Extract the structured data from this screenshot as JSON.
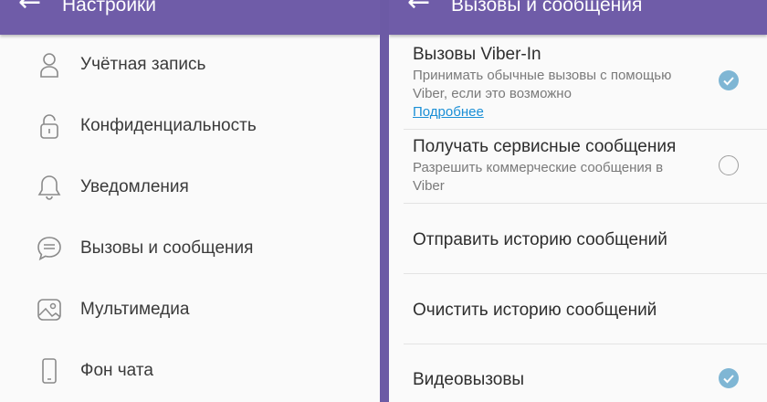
{
  "left_screen": {
    "title": "Настройки",
    "items": [
      {
        "label": "Учётная запись",
        "icon": "person-icon"
      },
      {
        "label": "Конфиденциальность",
        "icon": "lock-icon"
      },
      {
        "label": "Уведомления",
        "icon": "bell-icon"
      },
      {
        "label": "Вызовы и сообщения",
        "icon": "chat-icon"
      },
      {
        "label": "Мультимедиа",
        "icon": "image-icon"
      },
      {
        "label": "Фон чата",
        "icon": "phone-icon"
      }
    ]
  },
  "right_screen": {
    "title": "Вызовы и сообщения",
    "viber_in": {
      "title": "Вызовы Viber-In",
      "subtitle": "Принимать обычные вызовы с помощью Viber, если это возможно",
      "link": "Подробнее",
      "checked": true
    },
    "service_messages": {
      "title": "Получать сервисные сообщения",
      "subtitle": "Разрешить коммерческие сообщения в Viber",
      "checked": false
    },
    "send_history": "Отправить историю сообщений",
    "clear_history": "Очистить историю сообщений",
    "video_calls": {
      "title": "Видеовызовы",
      "checked": true
    }
  },
  "colors": {
    "appbar": "#6f5ca8",
    "check": "#7fb6d4",
    "link": "#1a8fd6"
  }
}
